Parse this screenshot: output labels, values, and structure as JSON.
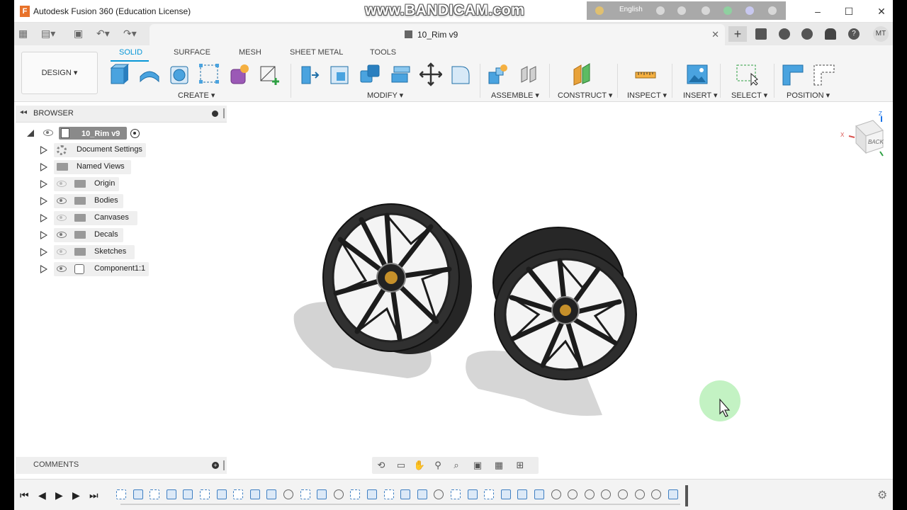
{
  "window": {
    "title": "Autodesk Fusion 360 (Education License)",
    "watermark": "www.BANDICAM.com",
    "ime_language": "English"
  },
  "tabs": {
    "document_title": "10_Rim v9",
    "user_initials": "MT"
  },
  "ribbon": {
    "workspace": "DESIGN ▾",
    "tabs": [
      "SOLID",
      "SURFACE",
      "MESH",
      "SHEET METAL",
      "TOOLS"
    ],
    "active_tab": "SOLID",
    "groups": [
      "CREATE ▾",
      "MODIFY ▾",
      "ASSEMBLE ▾",
      "CONSTRUCT ▾",
      "INSPECT ▾",
      "INSERT ▾",
      "SELECT ▾",
      "POSITION ▾"
    ]
  },
  "browser": {
    "title": "BROWSER",
    "root": "10_Rim v9",
    "items": [
      {
        "label": "Document Settings",
        "icon": "gear-icon",
        "visible": null
      },
      {
        "label": "Named Views",
        "icon": "folder-icon",
        "visible": null
      },
      {
        "label": "Origin",
        "icon": "folder-icon",
        "visible": false
      },
      {
        "label": "Bodies",
        "icon": "folder-icon",
        "visible": true
      },
      {
        "label": "Canvases",
        "icon": "folder-icon",
        "visible": false
      },
      {
        "label": "Decals",
        "icon": "folder-icon",
        "visible": true
      },
      {
        "label": "Sketches",
        "icon": "folder-icon",
        "visible": false
      },
      {
        "label": "Component1:1",
        "icon": "component-icon",
        "visible": true
      }
    ]
  },
  "viewcube": {
    "face": "BACK",
    "axes": [
      "X",
      "Z"
    ]
  },
  "comments": {
    "label": "COMMENTS"
  },
  "colors": {
    "accent": "#0696d7",
    "wheel": "#1c1c1c",
    "cursor_highlight": "#b9f0b9"
  }
}
